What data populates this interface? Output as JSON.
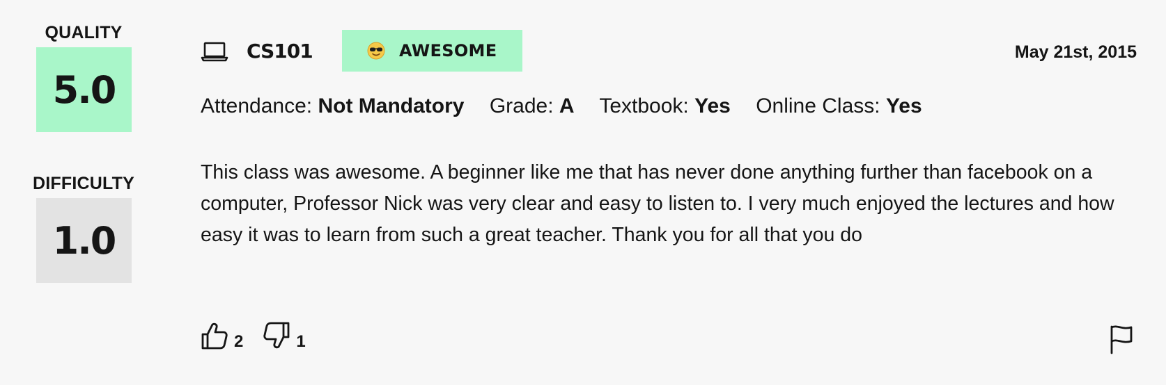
{
  "ratings": {
    "quality_label": "QUALITY",
    "quality_value": "5.0",
    "difficulty_label": "DIFFICULTY",
    "difficulty_value": "1.0"
  },
  "header": {
    "course_icon": "laptop-icon",
    "course": "CS101",
    "tag_icon": "sunglasses-emoji-icon",
    "tag": "AWESOME",
    "date": "May 21st, 2015"
  },
  "meta": [
    {
      "label": "Attendance:",
      "value": "Not Mandatory"
    },
    {
      "label": "Grade:",
      "value": "A"
    },
    {
      "label": "Textbook:",
      "value": "Yes"
    },
    {
      "label": "Online Class:",
      "value": "Yes"
    }
  ],
  "comment": "This class was awesome. A beginner like me that has never done anything further than facebook on a computer, Professor Nick was very clear and easy to listen to. I very much enjoyed the lectures and how easy it was to learn from such a great teacher. Thank you for all that you do",
  "footer": {
    "thumbs_up_icon": "thumbs-up-icon",
    "thumbs_up_count": "2",
    "thumbs_down_icon": "thumbs-down-icon",
    "thumbs_down_count": "1",
    "flag_icon": "flag-icon"
  },
  "colors": {
    "quality_box": "#a9f6c9",
    "difficulty_box": "#e3e3e3",
    "tag_bg": "#a9f6c9",
    "background": "#f7f7f7"
  }
}
